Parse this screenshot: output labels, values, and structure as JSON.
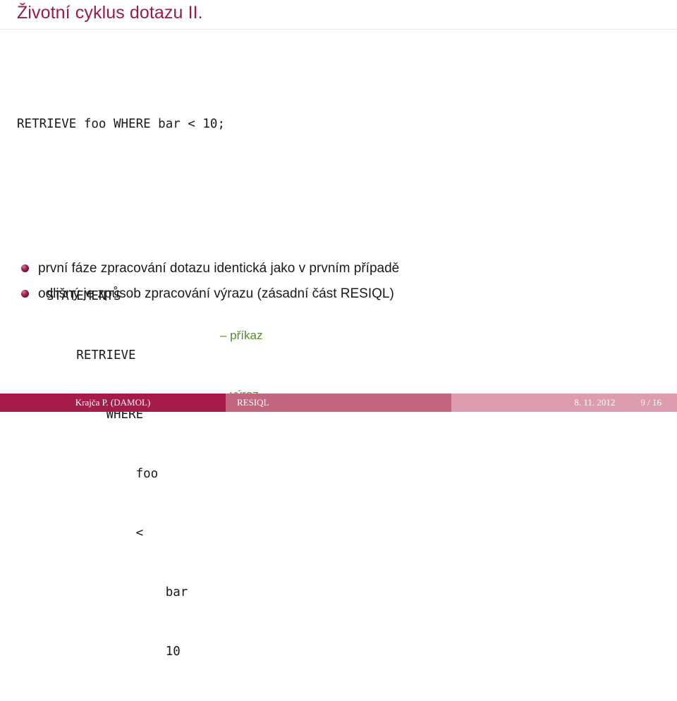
{
  "slide": {
    "title": "Životní cyklus dotazu II.",
    "title_color": "#9e1b40"
  },
  "code": {
    "query": "RETRIEVE foo WHERE bar < 10;",
    "tree": [
      {
        "text": "STATEMENTS",
        "annotation": ""
      },
      {
        "text": "    RETRIEVE",
        "annotation": "– příkaz"
      },
      {
        "text": "        WHERE",
        "annotation": "– výraz"
      },
      {
        "text": "            foo",
        "annotation": ""
      },
      {
        "text": "            <",
        "annotation": ""
      },
      {
        "text": "                bar",
        "annotation": ""
      },
      {
        "text": "                10",
        "annotation": ""
      }
    ],
    "annotation_color": "#4f8a2c"
  },
  "bullets": [
    {
      "text": "první fáze zpracování dotazu identická jako v prvním případě"
    },
    {
      "text": "odlišný je způsob zpracování výrazu (zásadní část RESIQL)"
    }
  ],
  "footer": {
    "author": "Krajča P.  (DAMOL)",
    "subject": "RESIQL",
    "date": "8. 11. 2012",
    "page": "9 / 16",
    "author_bg": "#a41c47",
    "subject_bg": "#c4657f",
    "meta_bg": "#dd9bae"
  }
}
